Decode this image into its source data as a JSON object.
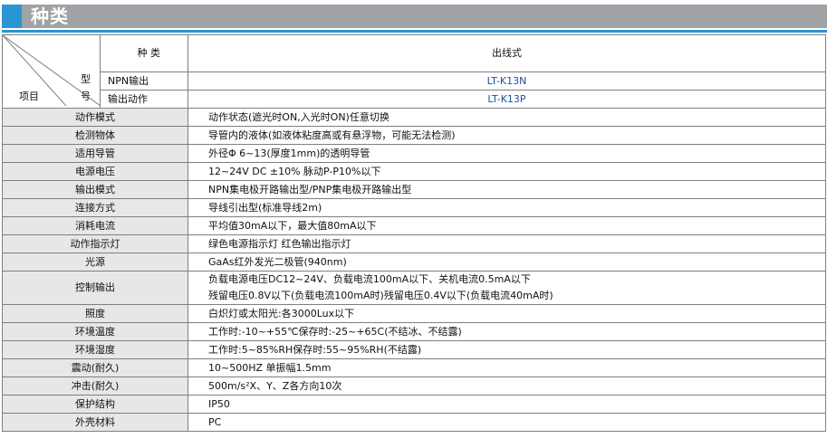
{
  "section_title": "种类",
  "header": {
    "kind_label": "种 类",
    "type_char": "型",
    "number_char": "号",
    "item_label": "项目",
    "npn_label": "NPN输出",
    "output_action_label": "输出动作",
    "column_title": "出线式",
    "model_npn": "LT-K13N",
    "model_output": "LT-K13P"
  },
  "rows": [
    {
      "label": "动作模式",
      "value": "动作状态(遮光时ON,入光时ON)任意切换"
    },
    {
      "label": "检测物体",
      "value": "导管内的液体(如液体粘度高或有悬浮物，可能无法检测)"
    },
    {
      "label": "适用导管",
      "value": "外径Φ 6~13(厚度1mm)的透明导管"
    },
    {
      "label": "电源电压",
      "value": "12~24V DC ±10% 脉动P-P10%以下"
    },
    {
      "label": "输出模式",
      "value": "NPN集电极开路输出型/PNP集电极开路输出型"
    },
    {
      "label": "连接方式",
      "value": "导线引出型(标准导线2m)"
    },
    {
      "label": "消耗电流",
      "value": "平均值30mA以下，最大值80mA以下"
    },
    {
      "label": "动作指示灯",
      "value": "绿色电源指示灯 红色输出指示灯"
    },
    {
      "label": "光源",
      "value": "GaAs红外发光二极管(940nm)"
    }
  ],
  "control_output": {
    "label": "控制输出",
    "line1": "负载电源电压DC12~24V、负载电流100mA以下、关机电流0.5mA以下",
    "line2": "残留电压0.8V以下(负载电流100mA时)残留电压0.4V以下(负载电流40mA时)"
  },
  "rows2": [
    {
      "label": "照度",
      "value": "白炽灯或太阳光:各3000Lux以下"
    },
    {
      "label": "环境温度",
      "value": "工作时:-10~+55℃保存时:-25~+65C(不结冰、不结露)"
    },
    {
      "label": "环境湿度",
      "value": "工作时:5~85%RH保存时:55~95%RH(不结露)"
    },
    {
      "label": "震动(耐久)",
      "value": "10~500HZ 单振幅1.5mm"
    },
    {
      "label": "冲击(耐久)",
      "value": "500m/s²X、Y、Z各方向10次"
    },
    {
      "label": "保护结构",
      "value": "IP50"
    },
    {
      "label": "外壳材料",
      "value": "PC"
    }
  ],
  "colors": {
    "title_bar": "#a1a2a6",
    "accent": "#2a95d4",
    "label_bg": "#e6e7e8",
    "model_text": "#1f4e9a"
  }
}
